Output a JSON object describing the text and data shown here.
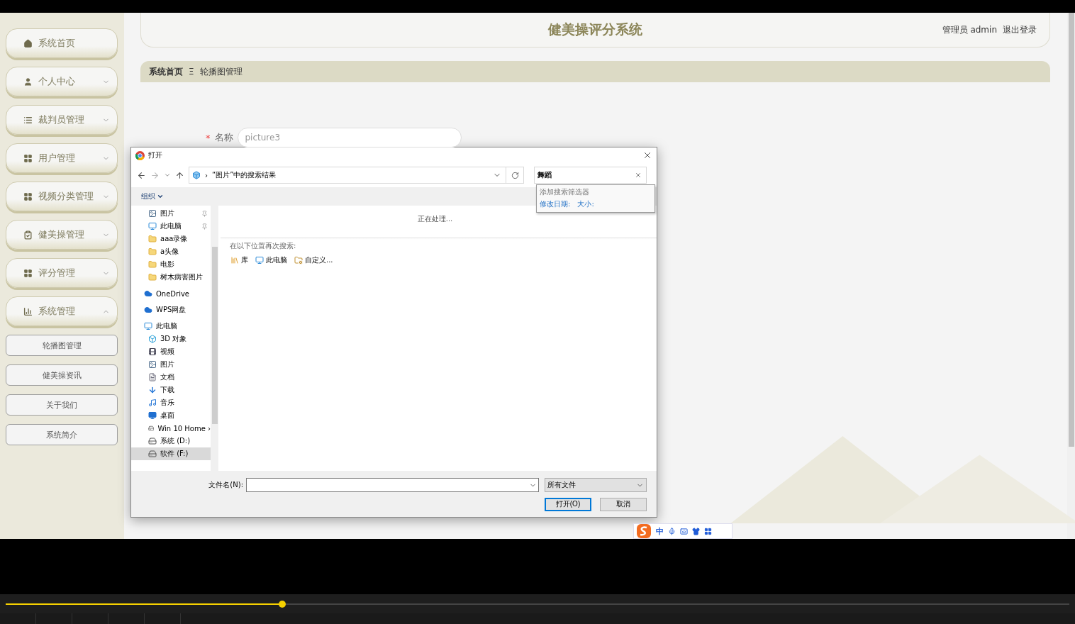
{
  "sidebar": {
    "items": [
      {
        "label": "系统首页",
        "kind": "home"
      },
      {
        "label": "个人中心",
        "kind": "user",
        "expanded": false
      },
      {
        "label": "裁判员管理",
        "kind": "list",
        "expanded": false
      },
      {
        "label": "用户管理",
        "kind": "grid",
        "expanded": false
      },
      {
        "label": "视频分类管理",
        "kind": "grid",
        "expanded": false
      },
      {
        "label": "健美操管理",
        "kind": "clipboard",
        "expanded": false
      },
      {
        "label": "评分管理",
        "kind": "grid",
        "expanded": false
      },
      {
        "label": "系统管理",
        "kind": "chart",
        "expanded": true,
        "children": [
          "轮播图管理",
          "健美操资讯",
          "关于我们",
          "系统简介"
        ]
      }
    ]
  },
  "header": {
    "title": "健美操评分系统",
    "user": "管理员 admin",
    "logout": "退出登录"
  },
  "breadcrumb": {
    "items": [
      "系统首页",
      "轮播图管理"
    ],
    "separator": "Ξ"
  },
  "form": {
    "label": "名称",
    "required": true,
    "required_mark": "*",
    "value": "picture3"
  },
  "dialog": {
    "title": "打开",
    "path_separator": "›",
    "path": "“图片”中的搜索结果",
    "search": "舞蹈",
    "search_filters": {
      "title": "添加搜索筛选器",
      "filters": [
        "修改日期:",
        "大小:"
      ]
    },
    "organize": "组织",
    "quick_access": [
      {
        "label": "图片",
        "kind": "pictures",
        "pinned": true
      },
      {
        "label": "此电脑",
        "kind": "pc",
        "pinned": true
      },
      {
        "label": "aaa录像",
        "kind": "folder",
        "pinned": false
      },
      {
        "label": "a头像",
        "kind": "folder",
        "pinned": false
      },
      {
        "label": "电影",
        "kind": "folder",
        "pinned": false
      },
      {
        "label": "树木病害图片",
        "kind": "folder",
        "pinned": false
      }
    ],
    "nav": [
      {
        "label": "OneDrive",
        "kind": "cloud",
        "selected": false
      },
      {
        "label": "WPS网盘",
        "kind": "cloud",
        "selected": false
      },
      {
        "label": "此电脑",
        "kind": "pc",
        "selected": false,
        "children": [
          {
            "label": "3D 对象",
            "kind": "cube",
            "selected": false
          },
          {
            "label": "视频",
            "kind": "video",
            "selected": false
          },
          {
            "label": "图片",
            "kind": "pictures",
            "selected": false
          },
          {
            "label": "文档",
            "kind": "docs",
            "selected": false
          },
          {
            "label": "下载",
            "kind": "download",
            "selected": false
          },
          {
            "label": "音乐",
            "kind": "music",
            "selected": false
          },
          {
            "label": "桌面",
            "kind": "desktop",
            "selected": false
          },
          {
            "label": "Win 10 Home ›",
            "kind": "drive",
            "selected": false
          },
          {
            "label": "系统 (D:)",
            "kind": "drive",
            "selected": false
          },
          {
            "label": "软件 (F:)",
            "kind": "drive",
            "selected": true
          }
        ]
      }
    ],
    "status": "正在处理...",
    "search_again": "在以下位置再次搜索:",
    "locations": [
      {
        "label": "库",
        "kind": "library"
      },
      {
        "label": "此电脑",
        "kind": "pc"
      },
      {
        "label": "自定义...",
        "kind": "custom"
      }
    ],
    "filename_label": "文件名(N):",
    "filetype": "所有文件",
    "buttons": [
      "打开(O)",
      "取消"
    ]
  },
  "ime": {
    "mode": "中"
  },
  "player": {
    "progress": {
      "level": 0.26
    }
  }
}
